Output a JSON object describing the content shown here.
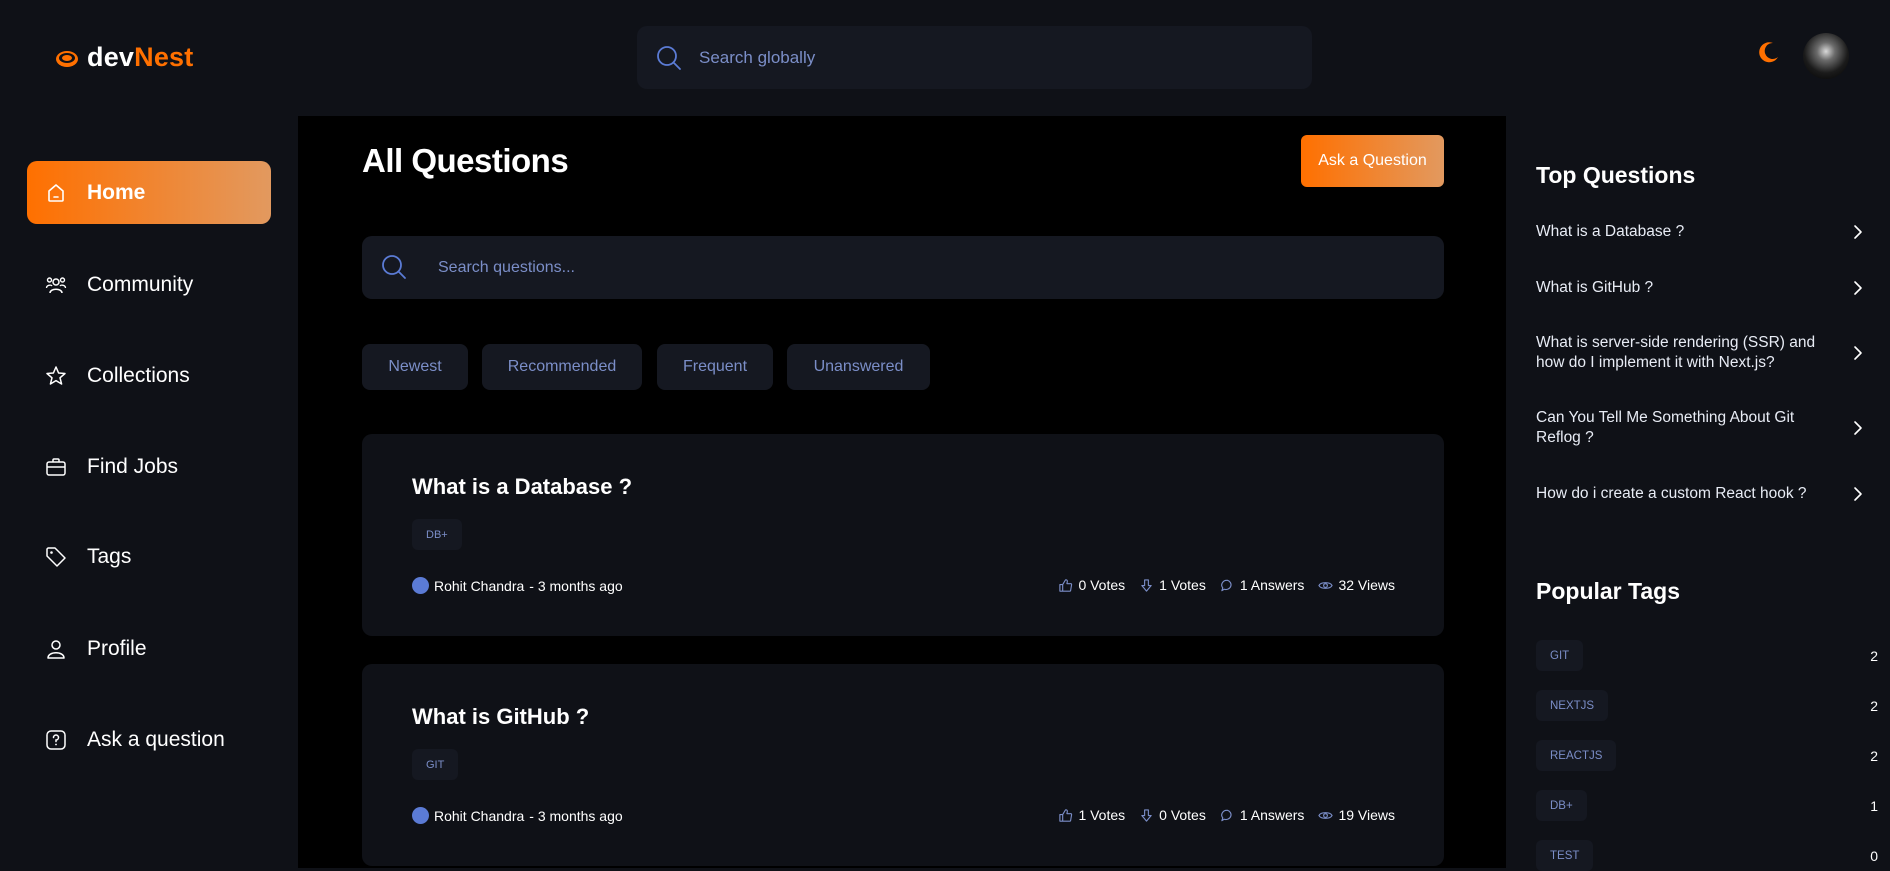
{
  "brand": {
    "part1": "dev",
    "part2": "Nest",
    "accent": "#ff7000"
  },
  "global_search": {
    "placeholder": "Search globally"
  },
  "sidebar": {
    "items": [
      {
        "label": "Home",
        "icon": "home-icon",
        "active": true
      },
      {
        "label": "Community",
        "icon": "users-icon"
      },
      {
        "label": "Collections",
        "icon": "star-icon"
      },
      {
        "label": "Find Jobs",
        "icon": "briefcase-icon"
      },
      {
        "label": "Tags",
        "icon": "tag-icon"
      },
      {
        "label": "Profile",
        "icon": "user-icon"
      },
      {
        "label": "Ask a question",
        "icon": "question-icon"
      }
    ]
  },
  "main": {
    "title": "All Questions",
    "ask_button": "Ask a Question",
    "search_placeholder": "Search questions...",
    "filters": [
      "Newest",
      "Recommended",
      "Frequent",
      "Unanswered"
    ],
    "questions": [
      {
        "title": "What is a Database ?",
        "tag": "DB+",
        "author": "Rohit Chandra",
        "time": "- 3 months ago",
        "upvotes": "0 Votes",
        "downvotes": "1 Votes",
        "answers": "1 Answers",
        "views": "32 Views"
      },
      {
        "title": "What is GitHub ?",
        "tag": "GIT",
        "author": "Rohit Chandra",
        "time": "- 3 months ago",
        "upvotes": "1 Votes",
        "downvotes": "0 Votes",
        "answers": "1 Answers",
        "views": "19 Views"
      }
    ]
  },
  "rightbar": {
    "top_title": "Top Questions",
    "top_questions": [
      "What is a Database ?",
      "What is GitHub ?",
      "What is server-side rendering (SSR) and how do I implement it with Next.js?",
      "Can You Tell Me Something About Git Reflog ?",
      "How do i create a custom React hook ?"
    ],
    "tags_title": "Popular Tags",
    "tags": [
      {
        "name": "GIT",
        "count": "2"
      },
      {
        "name": "NEXTJS",
        "count": "2"
      },
      {
        "name": "REACTJS",
        "count": "2"
      },
      {
        "name": "DB+",
        "count": "1"
      },
      {
        "name": "TEST",
        "count": "0"
      }
    ]
  }
}
